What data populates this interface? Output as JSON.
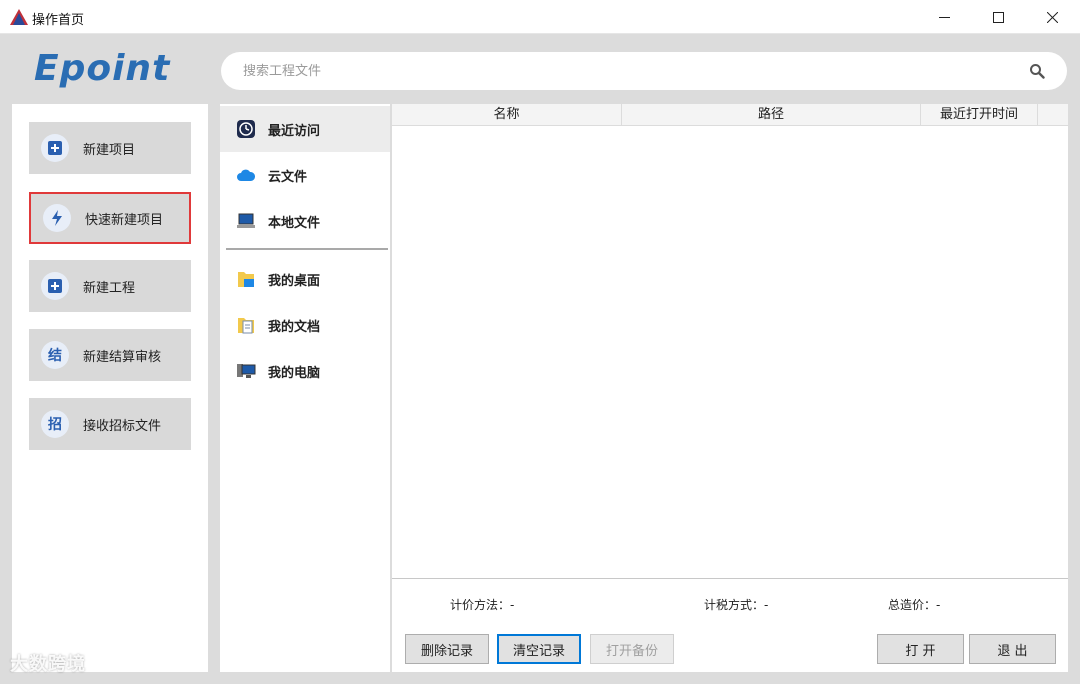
{
  "window": {
    "title": "操作首页"
  },
  "header": {
    "brand": "Epoint",
    "search_placeholder": "搜索工程文件"
  },
  "actions": [
    {
      "label": "新建项目",
      "icon_text": "+"
    },
    {
      "label": "快速新建项目",
      "icon_text": "⚡"
    },
    {
      "label": "新建工程",
      "icon_text": "+"
    },
    {
      "label": "新建结算审核",
      "icon_text": "结"
    },
    {
      "label": "接收招标文件",
      "icon_text": "招"
    }
  ],
  "nav": {
    "items": [
      {
        "label": "最近访问",
        "icon": "clock-icon"
      },
      {
        "label": "云文件",
        "icon": "cloud-icon"
      },
      {
        "label": "本地文件",
        "icon": "laptop-icon"
      },
      {
        "label": "我的桌面",
        "icon": "desktop-folder-icon"
      },
      {
        "label": "我的文档",
        "icon": "documents-folder-icon"
      },
      {
        "label": "我的电脑",
        "icon": "computer-icon"
      }
    ]
  },
  "table": {
    "columns": [
      "名称",
      "路径",
      "最近打开时间"
    ]
  },
  "info": {
    "pricing_method": "计价方法：-",
    "tax_method": "计税方式：-",
    "total_cost": "总造价：-"
  },
  "buttons": {
    "delete": "删除记录",
    "clear": "清空记录",
    "backup": "打开备份",
    "open": "打 开",
    "exit": "退 出"
  },
  "watermark": "大数跨境",
  "colors": {
    "brand": "#2a6db3",
    "selected_border": "#e0393a",
    "panel_bg": "#dcdcdc"
  }
}
